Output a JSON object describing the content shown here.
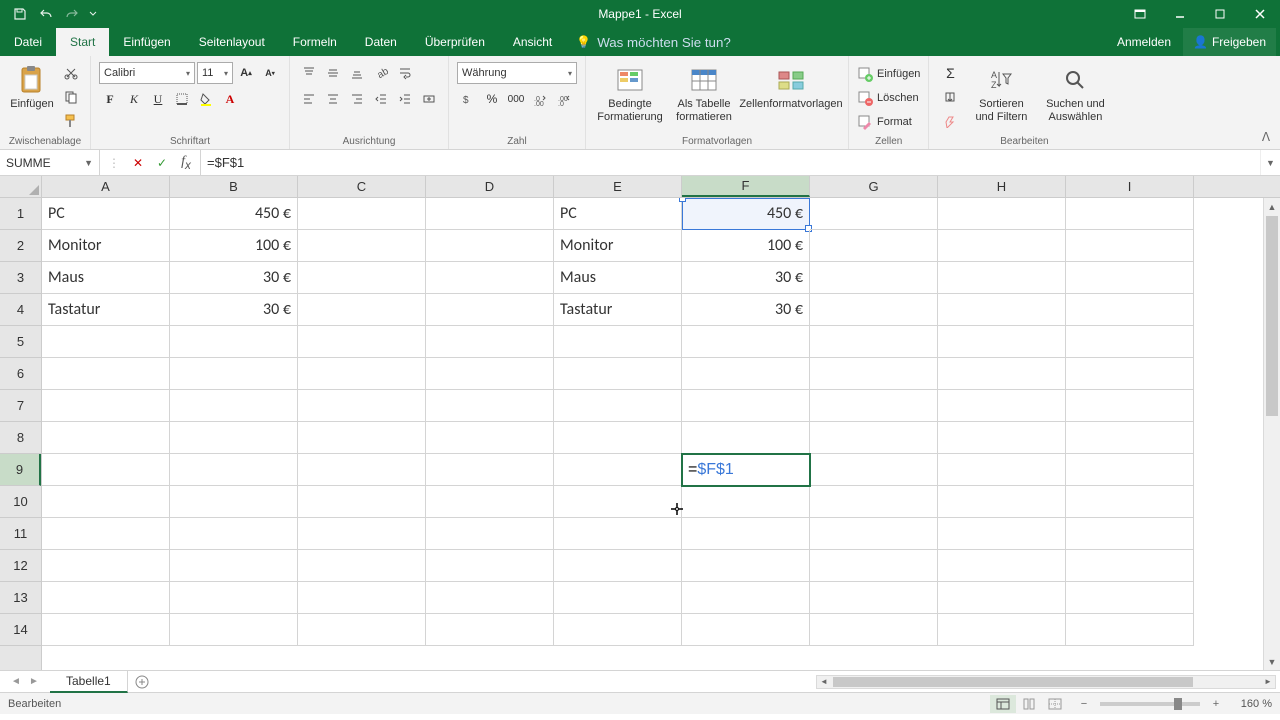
{
  "title": "Mappe1 - Excel",
  "tabs": {
    "file": "Datei",
    "home": "Start",
    "insert": "Einfügen",
    "pagelayout": "Seitenlayout",
    "formulas": "Formeln",
    "data": "Daten",
    "review": "Überprüfen",
    "view": "Ansicht"
  },
  "tellme_placeholder": "Was möchten Sie tun?",
  "signin": "Anmelden",
  "share": "Freigeben",
  "ribbon": {
    "clipboard": {
      "label": "Zwischenablage",
      "paste": "Einfügen"
    },
    "font": {
      "label": "Schriftart",
      "name": "Calibri",
      "size": "11"
    },
    "alignment": {
      "label": "Ausrichtung"
    },
    "number": {
      "label": "Zahl",
      "format": "Währung"
    },
    "styles": {
      "label": "Formatvorlagen",
      "cond": "Bedingte Formatierung",
      "table": "Als Tabelle formatieren",
      "cellstyles": "Zellenformatvorlagen"
    },
    "cells": {
      "label": "Zellen",
      "insert": "Einfügen",
      "delete": "Löschen",
      "format": "Format"
    },
    "editing": {
      "label": "Bearbeiten",
      "sort": "Sortieren und Filtern",
      "find": "Suchen und Auswählen"
    }
  },
  "name_box": "SUMME",
  "formula": "=$F$1",
  "columns": [
    "A",
    "B",
    "C",
    "D",
    "E",
    "F",
    "G",
    "H",
    "I"
  ],
  "row_count": 14,
  "active_col": "F",
  "active_row": 9,
  "ref_cell": {
    "col": "F",
    "row": 1
  },
  "cells": {
    "A1": "PC",
    "B1": "450 €",
    "A2": "Monitor",
    "B2": "100 €",
    "A3": "Maus",
    "B3": "30 €",
    "A4": "Tastatur",
    "B4": "30 €",
    "E1": "PC",
    "F1": "450 €",
    "E2": "Monitor",
    "F2": "100 €",
    "E3": "Maus",
    "F3": "30 €",
    "E4": "Tastatur",
    "F4": "30 €"
  },
  "editing_cell": {
    "col": "F",
    "row": 9,
    "prefix": "=",
    "ref": "$F$1"
  },
  "sheet_tab": "Tabelle1",
  "status_mode": "Bearbeiten",
  "zoom": "160 %"
}
